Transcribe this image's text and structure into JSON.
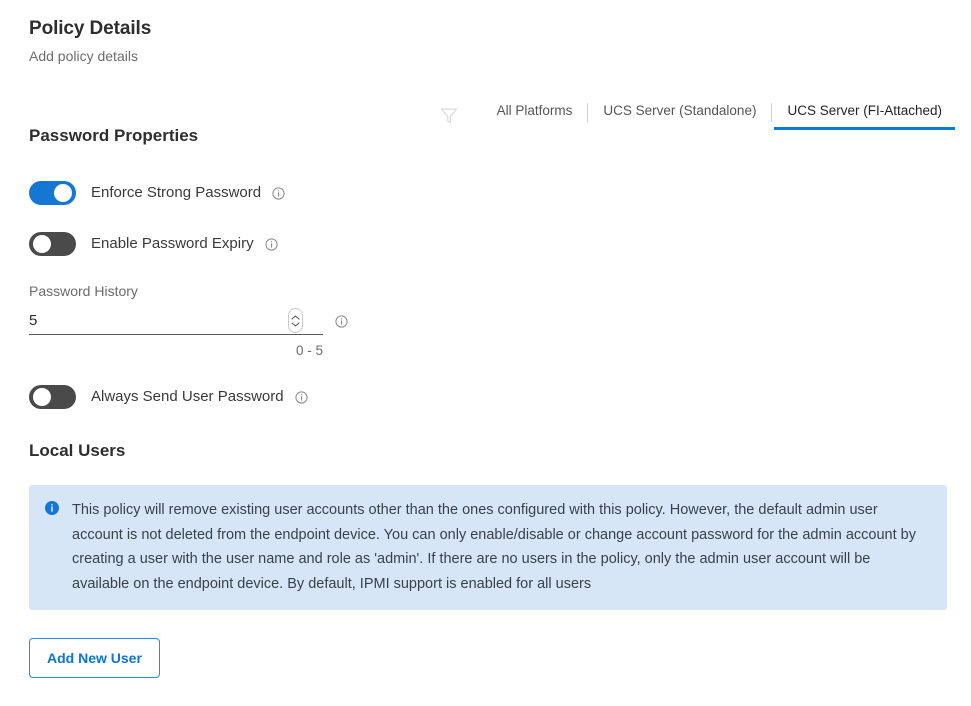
{
  "header": {
    "title": "Policy Details",
    "subtitle": "Add policy details"
  },
  "platform_filter": {
    "icon": "funnel-filter-icon",
    "tabs": [
      {
        "label": "All Platforms",
        "active": false
      },
      {
        "label": "UCS Server (Standalone)",
        "active": false
      },
      {
        "label": "UCS Server (FI-Attached)",
        "active": true
      }
    ]
  },
  "password_properties": {
    "title": "Password Properties",
    "toggles": [
      {
        "label": "Enforce Strong Password",
        "state": "on",
        "info_icon": "info-circle-icon"
      },
      {
        "label": "Enable Password Expiry",
        "state": "off",
        "info_icon": "info-circle-icon"
      }
    ],
    "password_history": {
      "label": "Password History",
      "value": "5",
      "placeholder": "",
      "hint": "0 - 5",
      "stepper_icon": "stepper-up-down-icon",
      "info_icon": "info-circle-icon"
    },
    "always_send": {
      "label": "Always Send User Password",
      "state": "off",
      "info_icon": "info-circle-icon"
    }
  },
  "local_users": {
    "title": "Local Users",
    "banner": {
      "icon": "info-filled-circle-icon",
      "text": "This policy will remove existing user accounts other than the ones configured with this policy. However, the default admin user account is not deleted from the endpoint device. You can only enable/disable or change account password for the admin account by creating a user with the user name and role as 'admin'. If there are no users in the policy, only the admin user account will be available on the endpoint device. By default, IPMI support is enabled for all users"
    },
    "add_user_button": "Add New User"
  },
  "colors": {
    "accent_blue": "#1577d4",
    "tab_underline": "#0d7bd4",
    "toggle_off": "#4a4a4a",
    "banner_bg": "#d6e6f7",
    "button_border": "#1f8cf0",
    "button_text": "#0a74d8"
  }
}
